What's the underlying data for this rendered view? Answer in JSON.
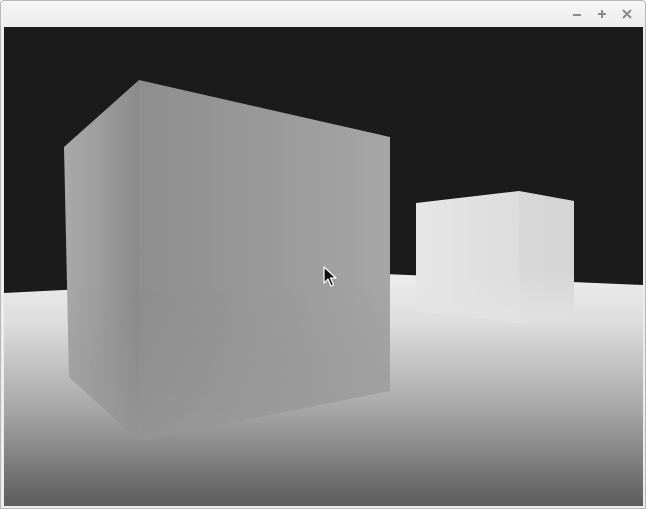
{
  "window": {
    "title": "",
    "controls": {
      "minimize": "minimize-icon",
      "maximize": "maximize-icon",
      "close": "close-icon"
    }
  },
  "scene": {
    "background_color": "#1b1b1b",
    "floor_colors": [
      "#e9e9e9",
      "#5e5e5e"
    ],
    "objects": [
      {
        "name": "large-box",
        "tone": "mid-gray"
      },
      {
        "name": "small-box",
        "tone": "light-gray"
      }
    ]
  },
  "cursor": {
    "icon": "arrow-cursor-icon"
  }
}
